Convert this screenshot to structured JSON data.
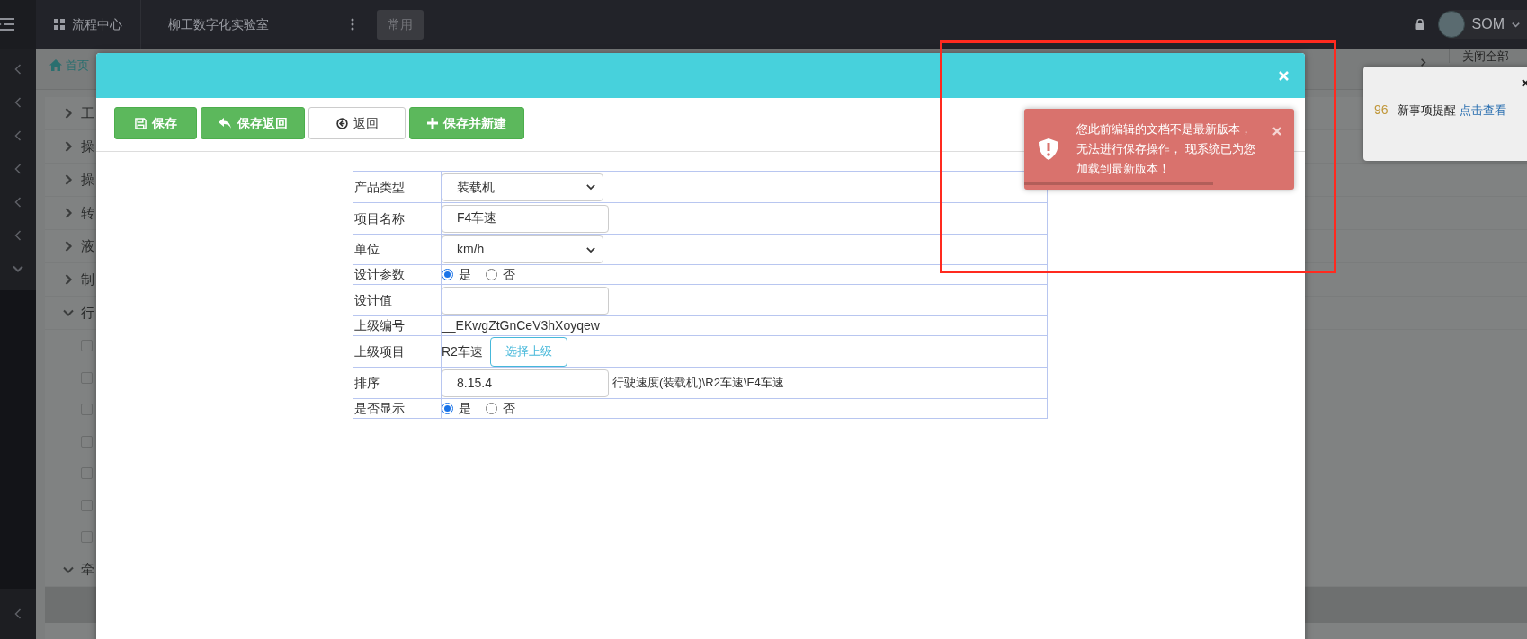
{
  "top_bar": {
    "nav": [
      {
        "label": "流程中心",
        "kind": "grid_link"
      },
      {
        "label": "柳工数字化实验室",
        "kind": "plain"
      }
    ],
    "common_button": "常用",
    "user": "SOM"
  },
  "side_rail": [
    {
      "expanded": false
    },
    {
      "expanded": false
    },
    {
      "expanded": false
    },
    {
      "expanded": false
    },
    {
      "expanded": false
    },
    {
      "expanded": false
    },
    {
      "expanded": true
    }
  ],
  "side_rail_bottom": {
    "expanded": false
  },
  "page_tabs": {
    "home": "首页",
    "close_all": "关闭全部"
  },
  "tree": [
    {
      "label": "工",
      "expanded": false
    },
    {
      "label": "操",
      "expanded": false
    },
    {
      "label": "操",
      "expanded": false
    },
    {
      "label": "转",
      "expanded": false
    },
    {
      "label": "液",
      "expanded": false
    },
    {
      "label": "制",
      "expanded": false
    },
    {
      "label": "行",
      "expanded": true,
      "children": [
        {
          "checked": false
        },
        {
          "checked": false
        },
        {
          "checked": false
        },
        {
          "checked": false
        },
        {
          "checked": false
        },
        {
          "checked": false
        },
        {
          "checked": false
        }
      ]
    },
    {
      "label": "牵",
      "expanded": true,
      "children": [
        {
          "selected": true
        }
      ]
    }
  ],
  "modal": {
    "toolbar": [
      {
        "label": "保存",
        "kind": "save"
      },
      {
        "label": "保存返回",
        "kind": "save_return"
      },
      {
        "label": "返回",
        "kind": "back"
      },
      {
        "label": "保存并新建",
        "kind": "save_new"
      }
    ],
    "form": [
      {
        "label": "产品类型",
        "kind": "select",
        "value": "装载机"
      },
      {
        "label": "项目名称",
        "kind": "input",
        "value": "F4车速"
      },
      {
        "label": "单位",
        "kind": "select",
        "value": "km/h"
      },
      {
        "label": "设计参数",
        "kind": "radio",
        "options": [
          {
            "label": "是",
            "selected": true
          },
          {
            "label": "否",
            "selected": false
          }
        ]
      },
      {
        "label": "设计值",
        "kind": "input"
      },
      {
        "label": "上级编号",
        "kind": "text",
        "value": "__EKwgZtGnCeV3hXoyqew"
      },
      {
        "label": "上级项目",
        "kind": "picker",
        "value": "R2车速",
        "button": "选择上级"
      },
      {
        "label": "排序",
        "kind": "input",
        "value": "8.15.4",
        "note": "行驶速度(装载机)\\R2车速\\F4车速"
      },
      {
        "label": "是否显示",
        "kind": "radio",
        "options": [
          {
            "label": "是",
            "selected": true
          },
          {
            "label": "否",
            "selected": false
          }
        ]
      }
    ]
  },
  "toast": {
    "message": "您此前编辑的文档不是最新版本，无法进行保存操作， 现系统已为您加载到最新版本！",
    "level": 0.7
  },
  "notice": {
    "count": "96",
    "text": "新事项提醒",
    "link": "点击查看"
  }
}
